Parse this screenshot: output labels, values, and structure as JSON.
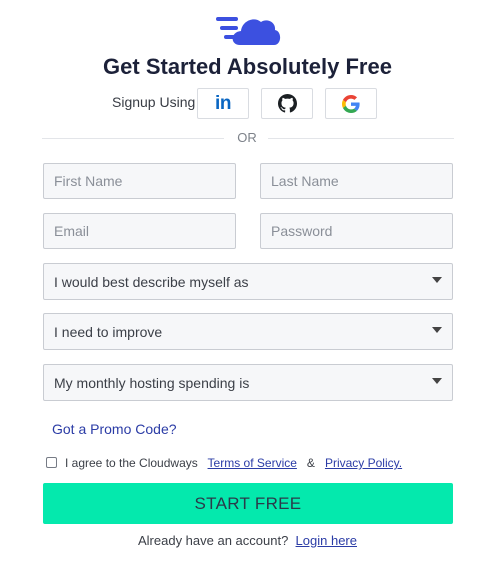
{
  "header": {
    "title": "Get Started Absolutely Free"
  },
  "social": {
    "label": "Signup Using",
    "linkedin_text": "in",
    "buttons": [
      {
        "name": "linkedin",
        "icon": "linkedin-icon"
      },
      {
        "name": "github",
        "icon": "github-icon"
      },
      {
        "name": "google",
        "icon": "google-icon"
      }
    ]
  },
  "divider": {
    "text": "OR"
  },
  "form": {
    "first_name_placeholder": "First Name",
    "last_name_placeholder": "Last Name",
    "email_placeholder": "Email",
    "password_placeholder": "Password",
    "describe_select": "I would best describe myself as",
    "improve_select": "I need to improve",
    "spending_select": "My monthly hosting spending is",
    "promo_link": "Got a Promo Code?",
    "agree_prefix": "I agree to the Cloudways",
    "terms_link": "Terms of Service",
    "ampersand": "&",
    "privacy_link": "Privacy Policy.",
    "submit_label": "START FREE"
  },
  "footer": {
    "account_text": "Already have an account?",
    "login_link": "Login here"
  },
  "colors": {
    "brand_blue": "#3c50e0",
    "submit_green": "#04e9ad",
    "link_blue": "#2b3ca6"
  }
}
